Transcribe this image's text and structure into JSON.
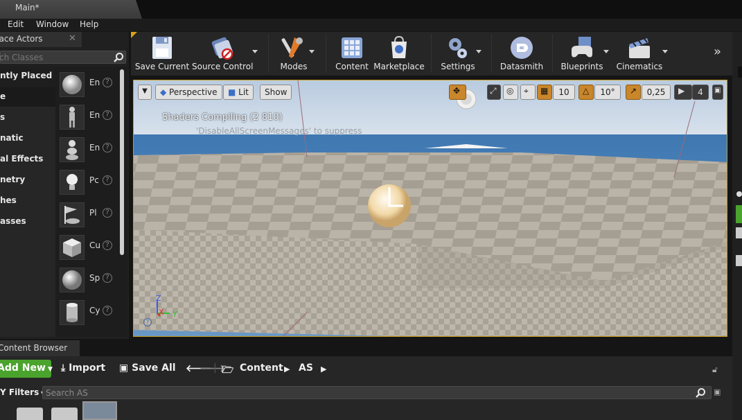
{
  "window": {
    "tab_title": "Main*"
  },
  "menu": [
    "Edit",
    "Window",
    "Help"
  ],
  "place_actors": {
    "title": "Place Actors",
    "search_placeholder": "ch Classes",
    "categories": [
      "ntly Placed",
      "e",
      "s",
      "natic",
      "al Effects",
      "netry",
      "hes",
      "asses"
    ],
    "items": [
      {
        "label": "En",
        "icon": "sphere-empty-icon"
      },
      {
        "label": "En",
        "icon": "character-icon"
      },
      {
        "label": "En",
        "icon": "pawn-icon"
      },
      {
        "label": "Pc",
        "icon": "point-light-icon"
      },
      {
        "label": "Pl",
        "icon": "player-start-icon"
      },
      {
        "label": "Cu",
        "icon": "cube-icon"
      },
      {
        "label": "Sp",
        "icon": "sphere-icon"
      },
      {
        "label": "Cy",
        "icon": "cylinder-icon"
      }
    ]
  },
  "toolbar": {
    "buttons": [
      {
        "label": "Save Current",
        "icon": "save-icon"
      },
      {
        "label": "Source Control",
        "icon": "source-control-icon"
      },
      {
        "label": "Modes",
        "icon": "modes-icon"
      },
      {
        "label": "Content",
        "icon": "content-icon"
      },
      {
        "label": "Marketplace",
        "icon": "marketplace-icon"
      },
      {
        "label": "Settings",
        "icon": "settings-icon"
      },
      {
        "label": "Datasmith",
        "icon": "datasmith-icon"
      },
      {
        "label": "Blueprints",
        "icon": "blueprints-icon"
      },
      {
        "label": "Cinematics",
        "icon": "cinematics-icon"
      }
    ],
    "more": "»"
  },
  "viewport": {
    "perspective_label": "Perspective",
    "lit_label": "Lit",
    "show_label": "Show",
    "grid_snap": "10",
    "rotation_snap": "10°",
    "scale_snap": "0,25",
    "camera_speed": "4",
    "shader_message": "Shaders Compiling (2 810)",
    "suppress_message": "'DisableAllScreenMessages' to suppress",
    "axis_labels": {
      "x": "X",
      "y": "Y",
      "z": "Z"
    }
  },
  "content_browser": {
    "title": "Content Browser",
    "add_new": "Add New",
    "import": "Import",
    "save_all": "Save All",
    "path": [
      "Content",
      "AS"
    ],
    "filters": "Filters",
    "search_placeholder": "Search AS"
  },
  "colors": {
    "accent": "#c99c1c",
    "add_new_green": "#4aa32c",
    "panel_bg": "#262626"
  }
}
